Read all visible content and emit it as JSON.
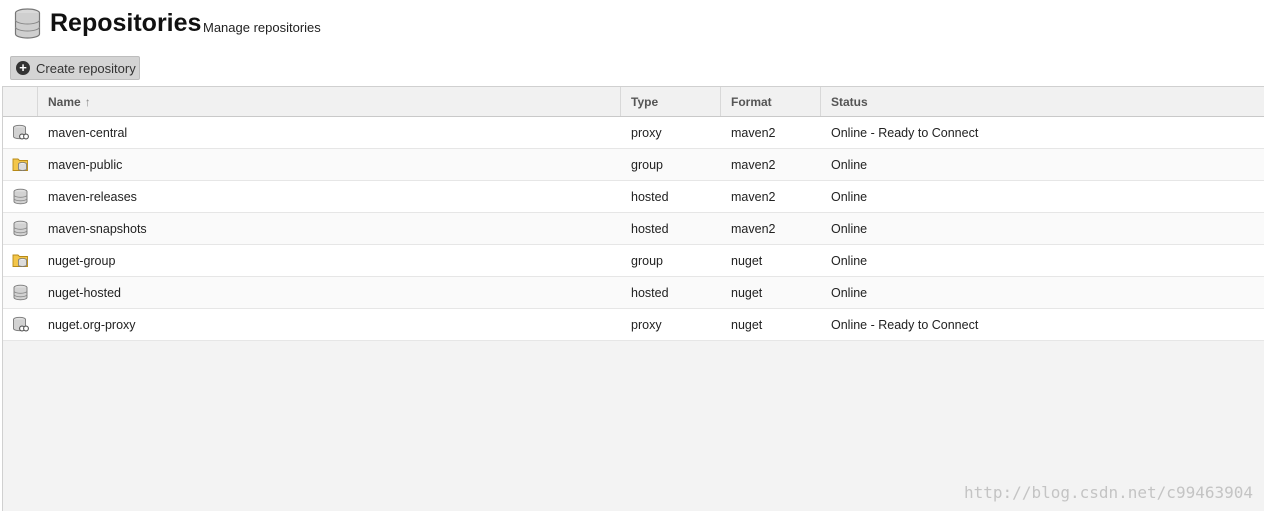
{
  "header": {
    "title": "Repositories",
    "subtitle": "Manage repositories",
    "icon": "database-icon"
  },
  "toolbar": {
    "create_label": "Create repository",
    "create_icon": "plus-circle-icon"
  },
  "grid": {
    "columns": [
      "Name",
      "Type",
      "Format",
      "Status"
    ],
    "sort_column": "Name",
    "sort_direction": "ascending",
    "rows": [
      {
        "icon": "proxy-repo-icon",
        "name": "maven-central",
        "type": "proxy",
        "format": "maven2",
        "status": "Online - Ready to Connect"
      },
      {
        "icon": "group-repo-icon",
        "name": "maven-public",
        "type": "group",
        "format": "maven2",
        "status": "Online"
      },
      {
        "icon": "hosted-repo-icon",
        "name": "maven-releases",
        "type": "hosted",
        "format": "maven2",
        "status": "Online"
      },
      {
        "icon": "hosted-repo-icon",
        "name": "maven-snapshots",
        "type": "hosted",
        "format": "maven2",
        "status": "Online"
      },
      {
        "icon": "group-repo-icon",
        "name": "nuget-group",
        "type": "group",
        "format": "nuget",
        "status": "Online"
      },
      {
        "icon": "hosted-repo-icon",
        "name": "nuget-hosted",
        "type": "hosted",
        "format": "nuget",
        "status": "Online"
      },
      {
        "icon": "proxy-repo-icon",
        "name": "nuget.org-proxy",
        "type": "proxy",
        "format": "nuget",
        "status": "Online - Ready to Connect"
      }
    ]
  },
  "watermark": "http://blog.csdn.net/c99463904"
}
